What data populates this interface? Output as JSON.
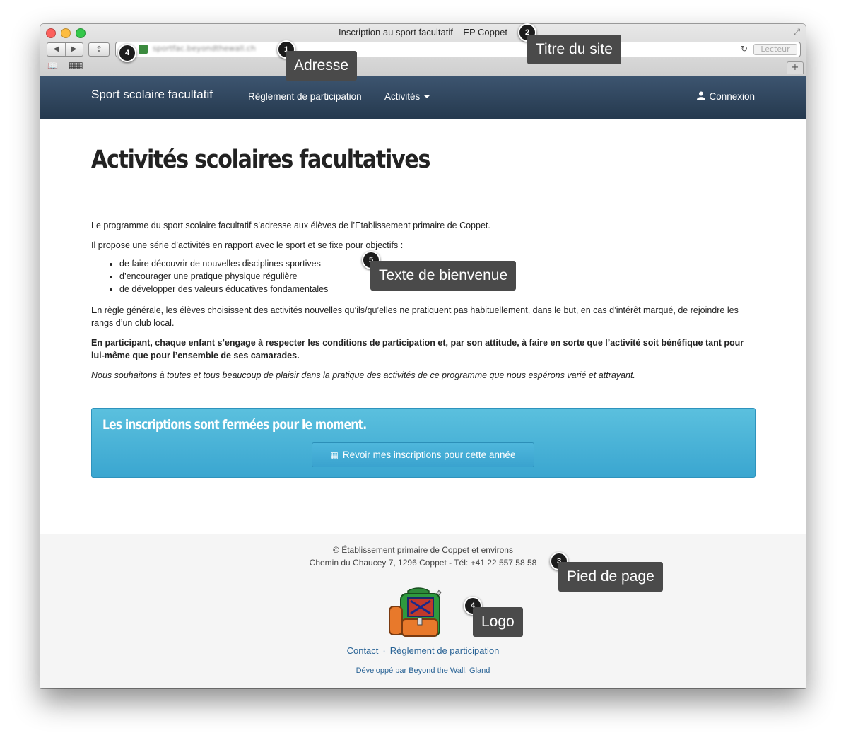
{
  "browser": {
    "window_title": "Inscription au sport facultatif – EP Coppet",
    "url": "sportfac.beyondthewall.ch",
    "reader_label": "Lecteur",
    "back_glyph": "◀",
    "forward_glyph": "▶",
    "share_glyph": "⇪",
    "reload_glyph": "↻",
    "newtab_glyph": "+",
    "fullscreen_glyph": "⤢",
    "bookmarks_glyph": "📖",
    "topsites_glyph": "▦▦"
  },
  "navbar": {
    "brand": "Sport scolaire facultatif",
    "rules": "Règlement de participation",
    "activities": "Activités",
    "login": "Connexion",
    "user_glyph": "👤"
  },
  "main": {
    "title": "Activités scolaires facultatives",
    "p1": "Le programme du sport scolaire facultatif s’adresse aux élèves de l’Etablissement primaire de Coppet.",
    "p2": "Il propose une série d’activités en rapport avec le sport et se fixe pour objectifs :",
    "goals": [
      "de faire découvrir de nouvelles disciplines sportives",
      "d’encourager une pratique physique régulière",
      "de développer des valeurs éducatives fondamentales"
    ],
    "p3": "En règle générale, les élèves choisissent des activités nouvelles qu’ils/qu’elles ne pratiquent pas habituellement, dans le but, en cas d’intérêt marqué, de rejoindre les rangs d’un club local.",
    "p4": "En participant, chaque enfant s’engage à respecter les conditions de participation et, par son attitude, à faire en sorte que l’activité soit bénéfique tant pour lui-même que pour l’ensemble de ses camarades.",
    "p5": "Nous souhaitons à toutes et tous beaucoup de plaisir dans la pratique des activités de ce programme que nous espérons varié et attrayant.",
    "alert_title": "Les inscriptions sont fermées pour le moment.",
    "alert_button": "Revoir mes inscriptions pour cette année",
    "calendar_glyph": "▦"
  },
  "footer": {
    "line1": "© Établissement primaire de Coppet et environs",
    "line2": "Chemin du Chaucey 7, 1296 Coppet - Tél: +41 22 557 58 58",
    "contact": "Contact",
    "separator": "·",
    "rules": "Règlement de participation",
    "developer": "Développé par Beyond the Wall, Gland"
  },
  "annotations": {
    "address": {
      "number": "1",
      "label": "Adresse"
    },
    "site_title": {
      "number": "2",
      "label": "Titre du site"
    },
    "footer": {
      "number": "3",
      "label": "Pied de page"
    },
    "logo": {
      "number": "4",
      "label": "Logo"
    },
    "favicon_number": "4",
    "welcome": {
      "number": "5",
      "label": "Texte de bienvenue"
    }
  },
  "colors": {
    "navbar": "#2f4660",
    "alert": "#4ab3da",
    "link": "#2a6496",
    "callout": "#4a4a4a"
  }
}
